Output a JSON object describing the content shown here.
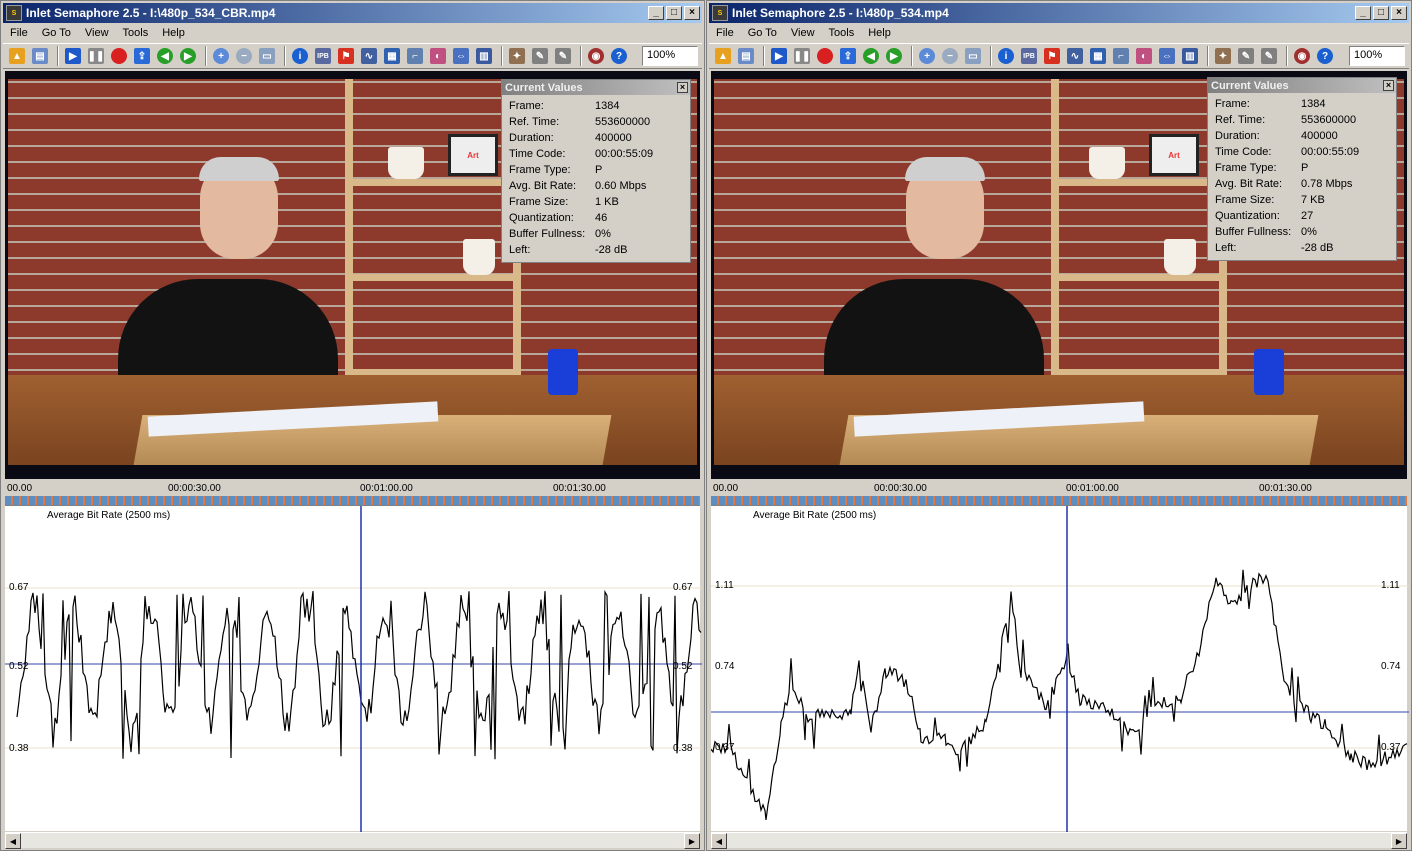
{
  "windows": [
    {
      "title": "Inlet Semaphore 2.5 - I:\\480p_534_CBR.mp4",
      "menu": [
        "File",
        "Go To",
        "View",
        "Tools",
        "Help"
      ],
      "zoom": "100%",
      "current_values": {
        "header": "Current Values",
        "rows": [
          {
            "label": "Frame:",
            "value": "1384"
          },
          {
            "label": "Ref. Time:",
            "value": "553600000"
          },
          {
            "label": "Duration:",
            "value": "400000"
          },
          {
            "label": "Time Code:",
            "value": "00:00:55:09"
          },
          {
            "label": "Frame Type:",
            "value": "P"
          },
          {
            "label": "Avg. Bit Rate:",
            "value": "0.60 Mbps"
          },
          {
            "label": "Frame Size:",
            "value": "1 KB"
          },
          {
            "label": "Quantization:",
            "value": "46"
          },
          {
            "label": "Buffer Fullness:",
            "value": "0%"
          },
          {
            "label": "Left:",
            "value": "-28 dB"
          }
        ]
      },
      "timeline_labels": [
        "00.00",
        "00:00:30.00",
        "00:01:00.00",
        "00:01:30.00"
      ],
      "graph": {
        "title": "Average Bit Rate (2500 ms)",
        "y_ticks_left": [
          "0.67",
          "0.52",
          "0.38"
        ],
        "y_ticks_right": [
          "0.67",
          "0.52",
          "0.38"
        ]
      }
    },
    {
      "title": "Inlet Semaphore 2.5 - I:\\480p_534.mp4",
      "menu": [
        "File",
        "Go To",
        "View",
        "Tools",
        "Help"
      ],
      "zoom": "100%",
      "current_values": {
        "header": "Current Values",
        "rows": [
          {
            "label": "Frame:",
            "value": "1384"
          },
          {
            "label": "Ref. Time:",
            "value": "553600000"
          },
          {
            "label": "Duration:",
            "value": "400000"
          },
          {
            "label": "Time Code:",
            "value": "00:00:55:09"
          },
          {
            "label": "Frame Type:",
            "value": "P"
          },
          {
            "label": "Avg. Bit Rate:",
            "value": "0.78 Mbps"
          },
          {
            "label": "Frame Size:",
            "value": "7 KB"
          },
          {
            "label": "Quantization:",
            "value": "27"
          },
          {
            "label": "Buffer Fullness:",
            "value": "0%"
          },
          {
            "label": "Left:",
            "value": "-28 dB"
          }
        ]
      },
      "timeline_labels": [
        "00.00",
        "00:00:30.00",
        "00:01:00.00",
        "00:01:30.00"
      ],
      "graph": {
        "title": "Average Bit Rate (2500 ms)",
        "y_ticks_left": [
          "1.11",
          "0.74",
          "0.37"
        ],
        "y_ticks_right": [
          "1.11",
          "0.74",
          "0.37"
        ]
      }
    }
  ],
  "colors": {
    "titlebar_start": "#0a246a",
    "titlebar_end": "#a6caf0",
    "cursor_line": "#2233aa",
    "mean_line": "#3344aa"
  }
}
